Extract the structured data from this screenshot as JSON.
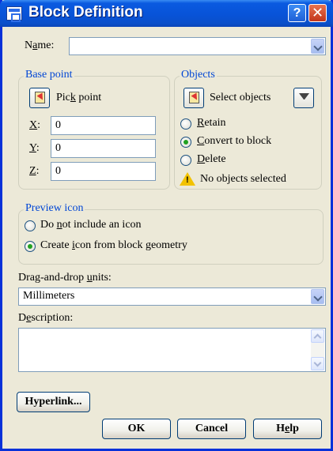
{
  "window": {
    "title": "Block Definition",
    "help_glyph": "?",
    "close_glyph": "✕"
  },
  "name": {
    "label_pre": "N",
    "label_u": "a",
    "label_post": "me:",
    "value": ""
  },
  "base_point": {
    "title": "Base point",
    "pick_pre": "Pic",
    "pick_u": "k",
    "pick_post": " point",
    "x_label": "X",
    "x_value": "0",
    "y_label": "Y",
    "y_value": "0",
    "z_label": "Z",
    "z_value": "0",
    "colon": ":"
  },
  "objects": {
    "title": "Objects",
    "select_label": "Select objects",
    "retain_u": "R",
    "retain_post": "etain",
    "convert_u": "C",
    "convert_post": "onvert to block",
    "delete_u": "D",
    "delete_post": "elete",
    "selected": "retain_no",
    "status": "No objects selected"
  },
  "preview": {
    "title": "Preview icon",
    "opt1_pre": "Do ",
    "opt1_u": "n",
    "opt1_post": "ot include an icon",
    "opt2_pre": "Create ",
    "opt2_u": "i",
    "opt2_post": "con from block geometry"
  },
  "units": {
    "label_pre": "Drag-and-drop ",
    "label_u": "u",
    "label_post": "nits:",
    "value": "Millimeters"
  },
  "description": {
    "label_pre": "D",
    "label_u": "e",
    "label_post": "scription:",
    "value": ""
  },
  "buttons": {
    "hyperlink": "Hyperlink...",
    "ok": "OK",
    "cancel": "Cancel",
    "help_pre": "H",
    "help_u": "e",
    "help_post": "lp"
  }
}
